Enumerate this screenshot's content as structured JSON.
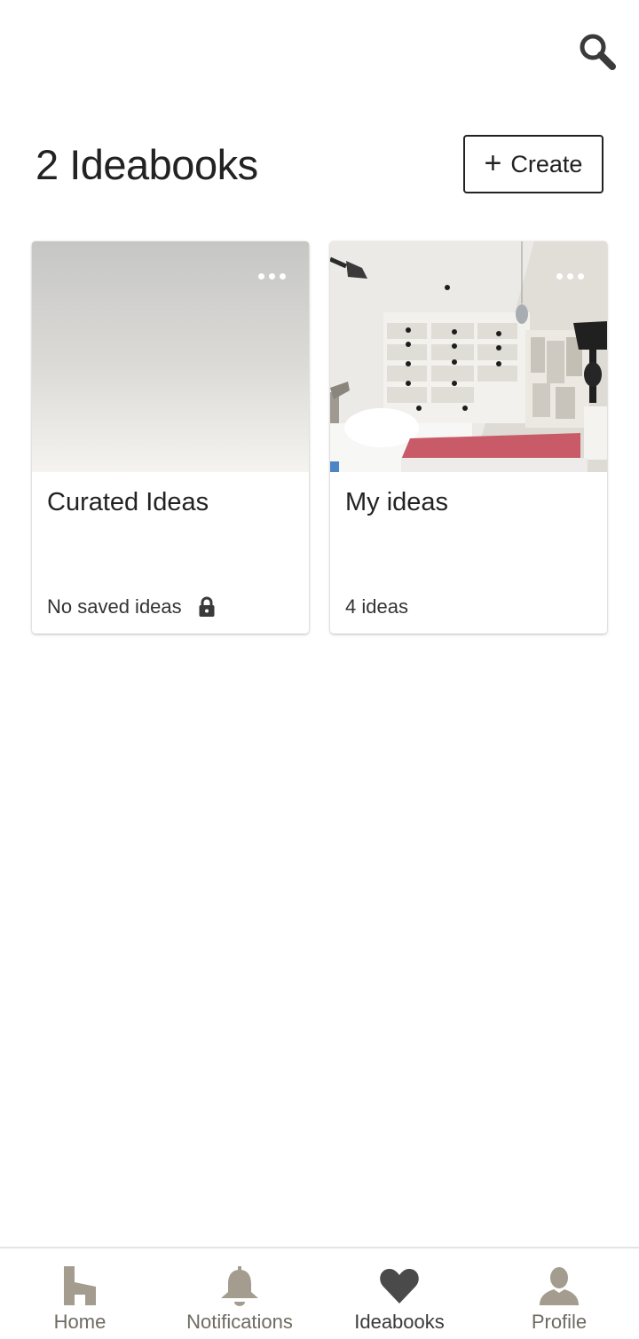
{
  "header": {
    "title": "2 Ideabooks",
    "create_label": "Create",
    "search_icon": "search-icon"
  },
  "ideabooks": [
    {
      "title": "Curated Ideas",
      "meta": "No saved ideas",
      "private": true
    },
    {
      "title": "My ideas",
      "meta": "4 ideas",
      "private": false
    }
  ],
  "nav": {
    "items": [
      {
        "label": "Home",
        "icon": "home-icon"
      },
      {
        "label": "Notifications",
        "icon": "bell-icon"
      },
      {
        "label": "Ideabooks",
        "icon": "heart-icon",
        "active": true
      },
      {
        "label": "Profile",
        "icon": "person-icon"
      }
    ]
  },
  "colors": {
    "text": "#222222",
    "nav_icon": "#a39c8f",
    "nav_icon_active": "#4a4a4a"
  }
}
